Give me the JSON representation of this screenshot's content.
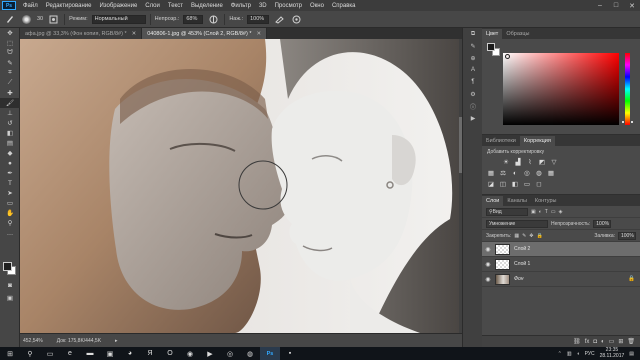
{
  "menubar": {
    "logo": "Ps",
    "items": [
      "Файл",
      "Редактирование",
      "Изображение",
      "Слои",
      "Текст",
      "Выделение",
      "Фильтр",
      "3D",
      "Просмотр",
      "Окно",
      "Справка"
    ],
    "window_buttons": {
      "minimize": "–",
      "maximize": "□",
      "close": "✕"
    }
  },
  "options": {
    "size": "30",
    "mode_label": "Режим:",
    "mode_value": "Нормальный",
    "opacity_label": "Непрозр.:",
    "opacity_value": "68%",
    "flow_label": "Наж.:",
    "flow_value": "100%"
  },
  "doc_tabs": [
    {
      "label": "афа.jpg @ 33,3% (Фон копия, RGB/8#) *",
      "active": false
    },
    {
      "label": "040806-1.jpg @ 453% (Слой 2, RGB/8#) *",
      "active": true
    }
  ],
  "status": {
    "zoom": "452,54%",
    "doc": "Док: 175,8K/444,5K"
  },
  "color_panel": {
    "tabs": [
      "Цвет",
      "Образцы"
    ]
  },
  "adjustments_panel": {
    "tabs": [
      "Библиотеки",
      "Коррекция"
    ],
    "title": "Добавить корректировку"
  },
  "layers_panel": {
    "tabs": [
      "Слои",
      "Каналы",
      "Контуры"
    ],
    "filter_label": "Вид",
    "blend_mode": "Умножение",
    "opacity_label": "Непрозрачность:",
    "opacity_value": "100%",
    "lock_label": "Закрепить:",
    "fill_label": "Заливка:",
    "fill_value": "100%",
    "layers": [
      {
        "name": "Слой 2",
        "selected": true,
        "thumb": "checker"
      },
      {
        "name": "Слой 1",
        "selected": false,
        "thumb": "checker"
      },
      {
        "name": "Фон",
        "selected": false,
        "thumb": "photo",
        "locked": true
      }
    ]
  },
  "taskbar": {
    "lang": "РУС",
    "time": "23:35",
    "date": "28.11.2017"
  }
}
